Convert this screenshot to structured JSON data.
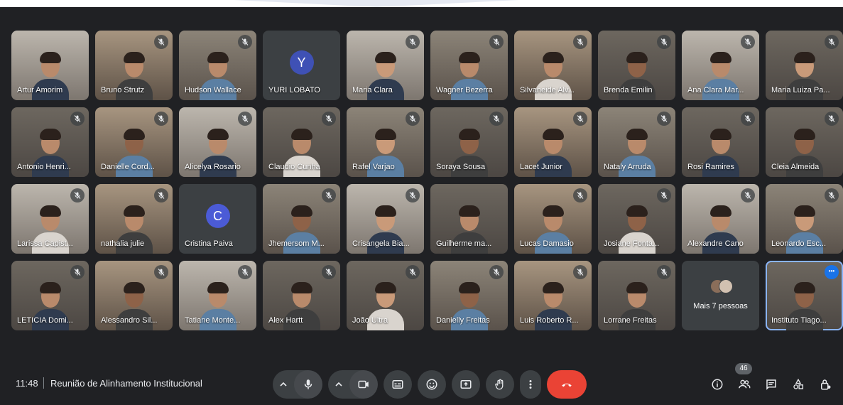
{
  "colors": {
    "background": "#202124",
    "tile": "#3c4043",
    "end_call": "#ea4335",
    "selected_outline": "#8ab4f8",
    "options_button": "#1a73e8"
  },
  "participants": [
    {
      "name": "Artur Amorim",
      "type": "video",
      "muted": false
    },
    {
      "name": "Bruno Strutz",
      "type": "video",
      "muted": true
    },
    {
      "name": "Hudson Wallace",
      "type": "video",
      "muted": true
    },
    {
      "name": "YURI LOBATO",
      "type": "avatar",
      "initial": "Y",
      "avatar_color": "#3f51b5",
      "muted": false
    },
    {
      "name": "Maria Clara",
      "type": "video",
      "muted": true
    },
    {
      "name": "Wagner Bezerra",
      "type": "video",
      "muted": true
    },
    {
      "name": "Silvaneide Alv...",
      "type": "video",
      "muted": true
    },
    {
      "name": "Brenda Emilin",
      "type": "video",
      "muted": true
    },
    {
      "name": "Ana Clara Mar...",
      "type": "video",
      "muted": true
    },
    {
      "name": "Maria Luiza Pa...",
      "type": "video",
      "muted": true
    },
    {
      "name": "Antonio Henri...",
      "type": "video",
      "muted": true
    },
    {
      "name": "Danielle Cord...",
      "type": "video",
      "muted": true
    },
    {
      "name": "Alicelya Rosario",
      "type": "video",
      "muted": true
    },
    {
      "name": "Claudio Cunha",
      "type": "video",
      "muted": true
    },
    {
      "name": "Rafel Varjao",
      "type": "video",
      "muted": true
    },
    {
      "name": "Soraya Sousa",
      "type": "video",
      "muted": true
    },
    {
      "name": "Lacet Junior",
      "type": "video",
      "muted": true
    },
    {
      "name": "Nataly Arruda",
      "type": "video",
      "muted": true
    },
    {
      "name": "Rosi Ramires",
      "type": "video",
      "muted": true
    },
    {
      "name": "Cleia Almeida",
      "type": "video",
      "muted": true
    },
    {
      "name": "Larissa Capist...",
      "type": "video",
      "muted": true
    },
    {
      "name": "nathalia julie",
      "type": "video",
      "muted": true
    },
    {
      "name": "Cristina Paiva",
      "type": "avatar",
      "initial": "C",
      "avatar_color": "#4b5bd6",
      "muted": false
    },
    {
      "name": "Jhemersom M...",
      "type": "video",
      "muted": true
    },
    {
      "name": "Crisangela Bia...",
      "type": "video",
      "muted": true
    },
    {
      "name": "Guilherme ma...",
      "type": "video",
      "muted": false
    },
    {
      "name": "Lucas Damasio",
      "type": "video",
      "muted": true
    },
    {
      "name": "Josiane Fonta...",
      "type": "video",
      "muted": true
    },
    {
      "name": "Alexandre Cano",
      "type": "video",
      "muted": true
    },
    {
      "name": "Leonardo Esc...",
      "type": "video",
      "muted": true
    },
    {
      "name": "LETICIA Domi...",
      "type": "video",
      "muted": true
    },
    {
      "name": "Alessandro Sil...",
      "type": "video",
      "muted": true
    },
    {
      "name": "Tatiane Monte...",
      "type": "video",
      "muted": true
    },
    {
      "name": "Alex Hartt",
      "type": "video",
      "muted": true
    },
    {
      "name": "João Ultra",
      "type": "video",
      "muted": true
    },
    {
      "name": "Danielly Freitas",
      "type": "video",
      "muted": true
    },
    {
      "name": "Luis Roberto R...",
      "type": "video",
      "muted": true
    },
    {
      "name": "Lorrane Freitas",
      "type": "video",
      "muted": true
    }
  ],
  "more_tile": {
    "label": "Mais 7 pessoas"
  },
  "self_tile": {
    "name": "Instituto Tiago...",
    "options_icon": "more-horizontal-icon"
  },
  "bottom_bar": {
    "time": "11:48",
    "separator": "|",
    "meeting_title": "Reunião de Alinhamento Institucional",
    "controls": [
      {
        "id": "mic",
        "icon": "microphone-icon"
      },
      {
        "id": "camera",
        "icon": "camera-icon"
      },
      {
        "id": "captions",
        "icon": "captions-icon"
      },
      {
        "id": "reactions",
        "icon": "emoji-icon"
      },
      {
        "id": "present",
        "icon": "present-screen-icon"
      },
      {
        "id": "raise-hand",
        "icon": "hand-icon"
      },
      {
        "id": "more",
        "icon": "more-vert-icon"
      },
      {
        "id": "leave",
        "icon": "end-call-icon"
      }
    ],
    "right": [
      {
        "id": "info",
        "icon": "info-icon"
      },
      {
        "id": "people",
        "icon": "people-icon",
        "count": "46"
      },
      {
        "id": "chat",
        "icon": "chat-icon"
      },
      {
        "id": "activities",
        "icon": "activities-icon"
      },
      {
        "id": "host-controls",
        "icon": "host-lock-icon"
      }
    ]
  }
}
